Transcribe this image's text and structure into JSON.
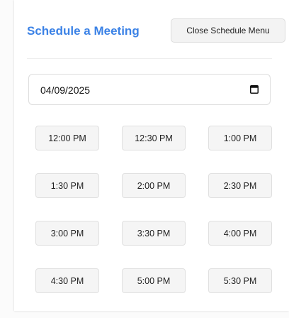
{
  "header": {
    "title": "Schedule a Meeting",
    "close_label": "Close Schedule Menu"
  },
  "date_input": {
    "value": "04/09/2025",
    "icon": "calendar-icon"
  },
  "time_slots": [
    "12:00 PM",
    "12:30 PM",
    "1:00 PM",
    "1:30 PM",
    "2:00 PM",
    "2:30 PM",
    "3:00 PM",
    "3:30 PM",
    "4:00 PM",
    "4:30 PM",
    "5:00 PM",
    "5:30 PM"
  ],
  "colors": {
    "accent": "#3b82e6",
    "button_bg": "#f5f5f5",
    "border": "#dddddd"
  }
}
